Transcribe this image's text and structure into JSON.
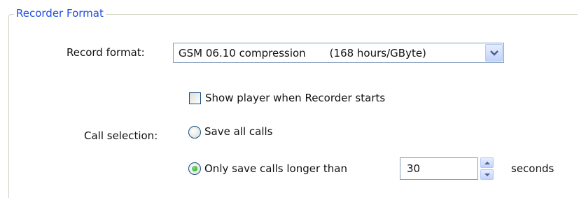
{
  "group": {
    "title": "Recorder Format"
  },
  "record_format": {
    "label": "Record format:",
    "selected_value": "GSM 06.10 compression",
    "selected_detail": "(168 hours/GByte)"
  },
  "show_player": {
    "label": "Show player when Recorder starts",
    "checked": false
  },
  "call_selection": {
    "label": "Call selection:",
    "options": [
      {
        "label": "Save all calls",
        "selected": false
      },
      {
        "label": "Only save calls longer than",
        "selected": true
      }
    ],
    "min_seconds_value": "30",
    "unit_label": "seconds"
  },
  "colors": {
    "group_title": "#1e4fe0",
    "control_border": "#7f9db9",
    "radio_dot": "#21a121"
  },
  "icons": {
    "dropdown": "chevron-down-icon",
    "spin_up": "triangle-up-icon",
    "spin_down": "triangle-down-icon"
  }
}
